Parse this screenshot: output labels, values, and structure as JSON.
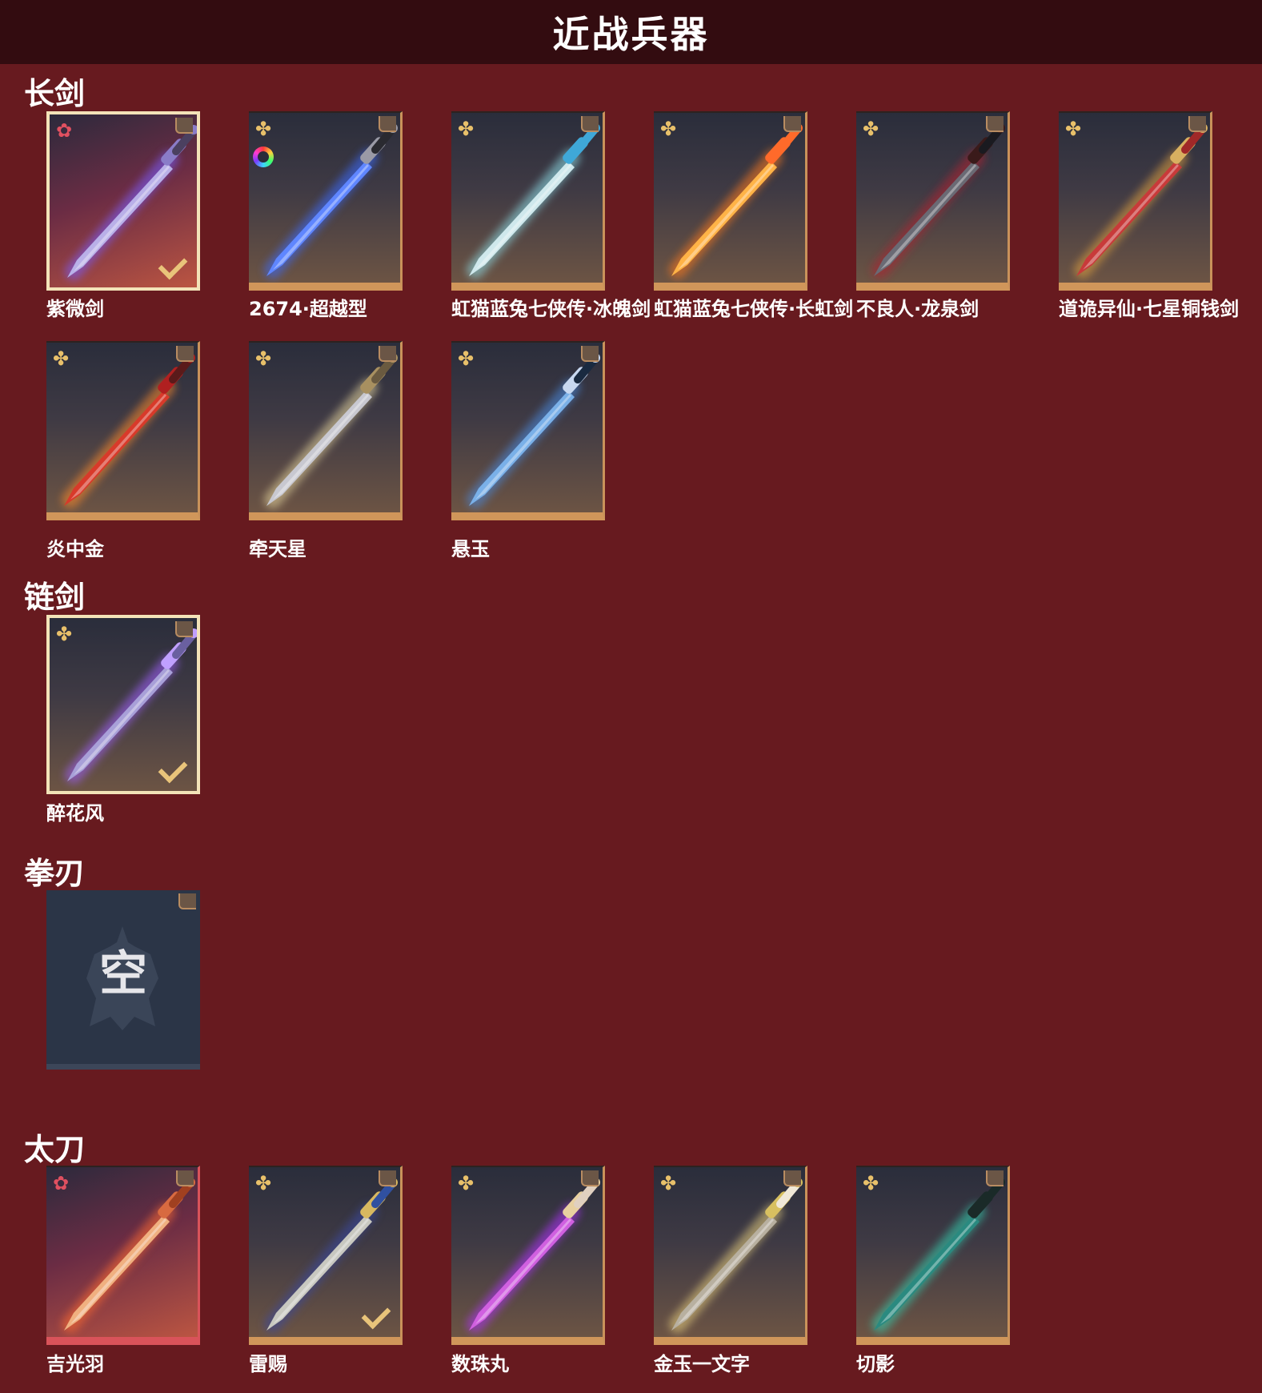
{
  "header": {
    "title": "近战兵器"
  },
  "sections": [
    {
      "title": "长剑",
      "items": [
        {
          "name": "紫微剑",
          "rarity": "red",
          "equipped": true
        },
        {
          "name": "2674·超越型",
          "rarity": "gold",
          "color_icon": true
        },
        {
          "name": "虹猫蓝兔七侠传·冰魄剑",
          "rarity": "gold"
        },
        {
          "name": "虹猫蓝兔七侠传·长虹剑",
          "rarity": "gold"
        },
        {
          "name": "不良人·龙泉剑",
          "rarity": "gold"
        },
        {
          "name": "道诡异仙·七星铜钱剑",
          "rarity": "gold"
        },
        {
          "name": "炎中金",
          "rarity": "gold"
        },
        {
          "name": "牵天星",
          "rarity": "gold"
        },
        {
          "name": "悬玉",
          "rarity": "gold"
        }
      ]
    },
    {
      "title": "链剑",
      "items": [
        {
          "name": "醉花风",
          "rarity": "gold",
          "equipped": true
        }
      ]
    },
    {
      "title": "拳刃",
      "items": [
        {
          "name": "",
          "empty": true,
          "empty_text": "空"
        }
      ]
    },
    {
      "title": "太刀",
      "items": [
        {
          "name": "吉光羽",
          "rarity": "red"
        },
        {
          "name": "雷赐",
          "rarity": "gold",
          "equipped_check": true
        },
        {
          "name": "数珠丸",
          "rarity": "gold"
        },
        {
          "name": "金玉一文字",
          "rarity": "gold"
        },
        {
          "name": "切影",
          "rarity": "gold"
        }
      ]
    }
  ],
  "colors": {
    "background": "#671a1f",
    "header_bar": "#330c10",
    "gold_icon": "#e8c06a",
    "red_icon": "#e05060"
  },
  "icons": {
    "gold_rarity": "gold-flower-icon",
    "red_rarity": "red-star-icon",
    "equipped": "checkmark-icon",
    "color_variant": "color-wheel-icon",
    "corner": "corner-tag-icon"
  }
}
